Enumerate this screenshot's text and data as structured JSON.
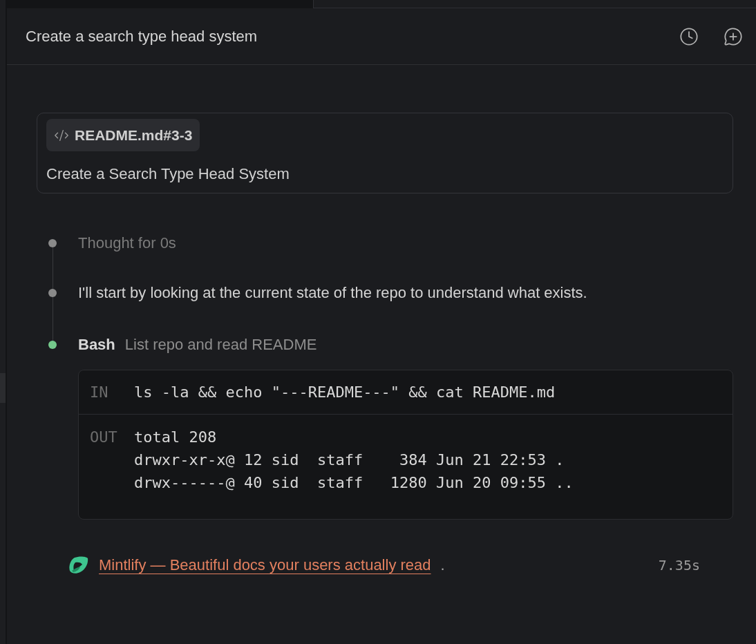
{
  "header": {
    "title": "Create a search type head system"
  },
  "prompt_card": {
    "reference": "README.md#3-3",
    "text": "Create a Search Type Head System"
  },
  "steps": [
    {
      "kind": "thought",
      "text": "Thought for 0s",
      "color": "#8a8a8a"
    },
    {
      "kind": "message",
      "text": "I'll start by looking at the current state of the repo to understand what exists.",
      "color": "#8a8a8a"
    },
    {
      "kind": "tool",
      "tool": "Bash",
      "description": "List repo and read README",
      "color": "#74c98b",
      "input_label": "IN",
      "input": "ls -la && echo \"---README---\" && cat README.md",
      "output_label": "OUT",
      "output": [
        "total 208",
        "drwxr-xr-x@ 12 sid  staff    384 Jun 21 22:53 .",
        "drwx------@ 40 sid  staff   1280 Jun 20 09:55 .."
      ]
    }
  ],
  "footer": {
    "link": "Mintlify — Beautiful docs your users actually read",
    "suffix": ".",
    "duration": "7.35s"
  }
}
